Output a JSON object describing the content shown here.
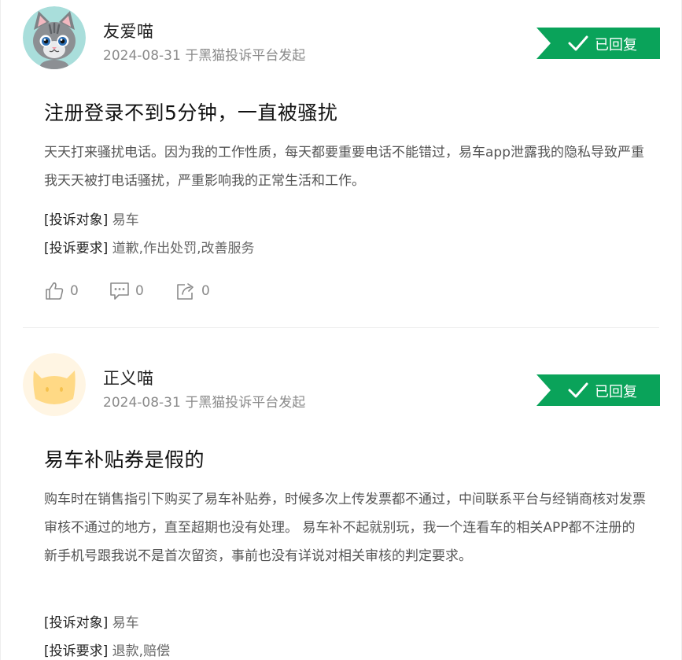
{
  "colors": {
    "accent_green": "#0aa35a",
    "meta_gray": "#8a8a8a",
    "body_gray": "#555555"
  },
  "posts": [
    {
      "avatar_icon": "gray-cat-avatar-icon",
      "username": "友爱喵",
      "meta": "2024-08-31 于黑猫投诉平台发起",
      "status_badge": "已回复",
      "title": "注册登录不到5分钟，一直被骚扰",
      "body": "天天打来骚扰电话。因为我的工作性质，每天都要重要电话不能错过，易车app泄露我的隐私导致严重我天天被打电话骚扰，严重影响我的正常生活和工作。",
      "target_key": "[投诉对象]",
      "target_value": "易车",
      "demand_key": "[投诉要求]",
      "demand_value": "道歉,作出处罚,改善服务",
      "likes": "0",
      "comments": "0",
      "shares": "0"
    },
    {
      "avatar_icon": "yellow-cat-avatar-icon",
      "username": "正义喵",
      "meta": "2024-08-31 于黑猫投诉平台发起",
      "status_badge": "已回复",
      "title": "易车补贴券是假的",
      "body": "购车时在销售指引下购买了易车补贴券，时候多次上传发票都不通过，中间联系平台与经销商核对发票审核不通过的地方，直至超期也没有处理。 易车补不起就别玩，我一个连看车的相关APP都不注册的新手机号跟我说不是首次留资，事前也没有详说对相关审核的判定要求。",
      "target_key": "[投诉对象]",
      "target_value": "易车",
      "demand_key": "[投诉要求]",
      "demand_value": "退款,赔偿"
    }
  ]
}
